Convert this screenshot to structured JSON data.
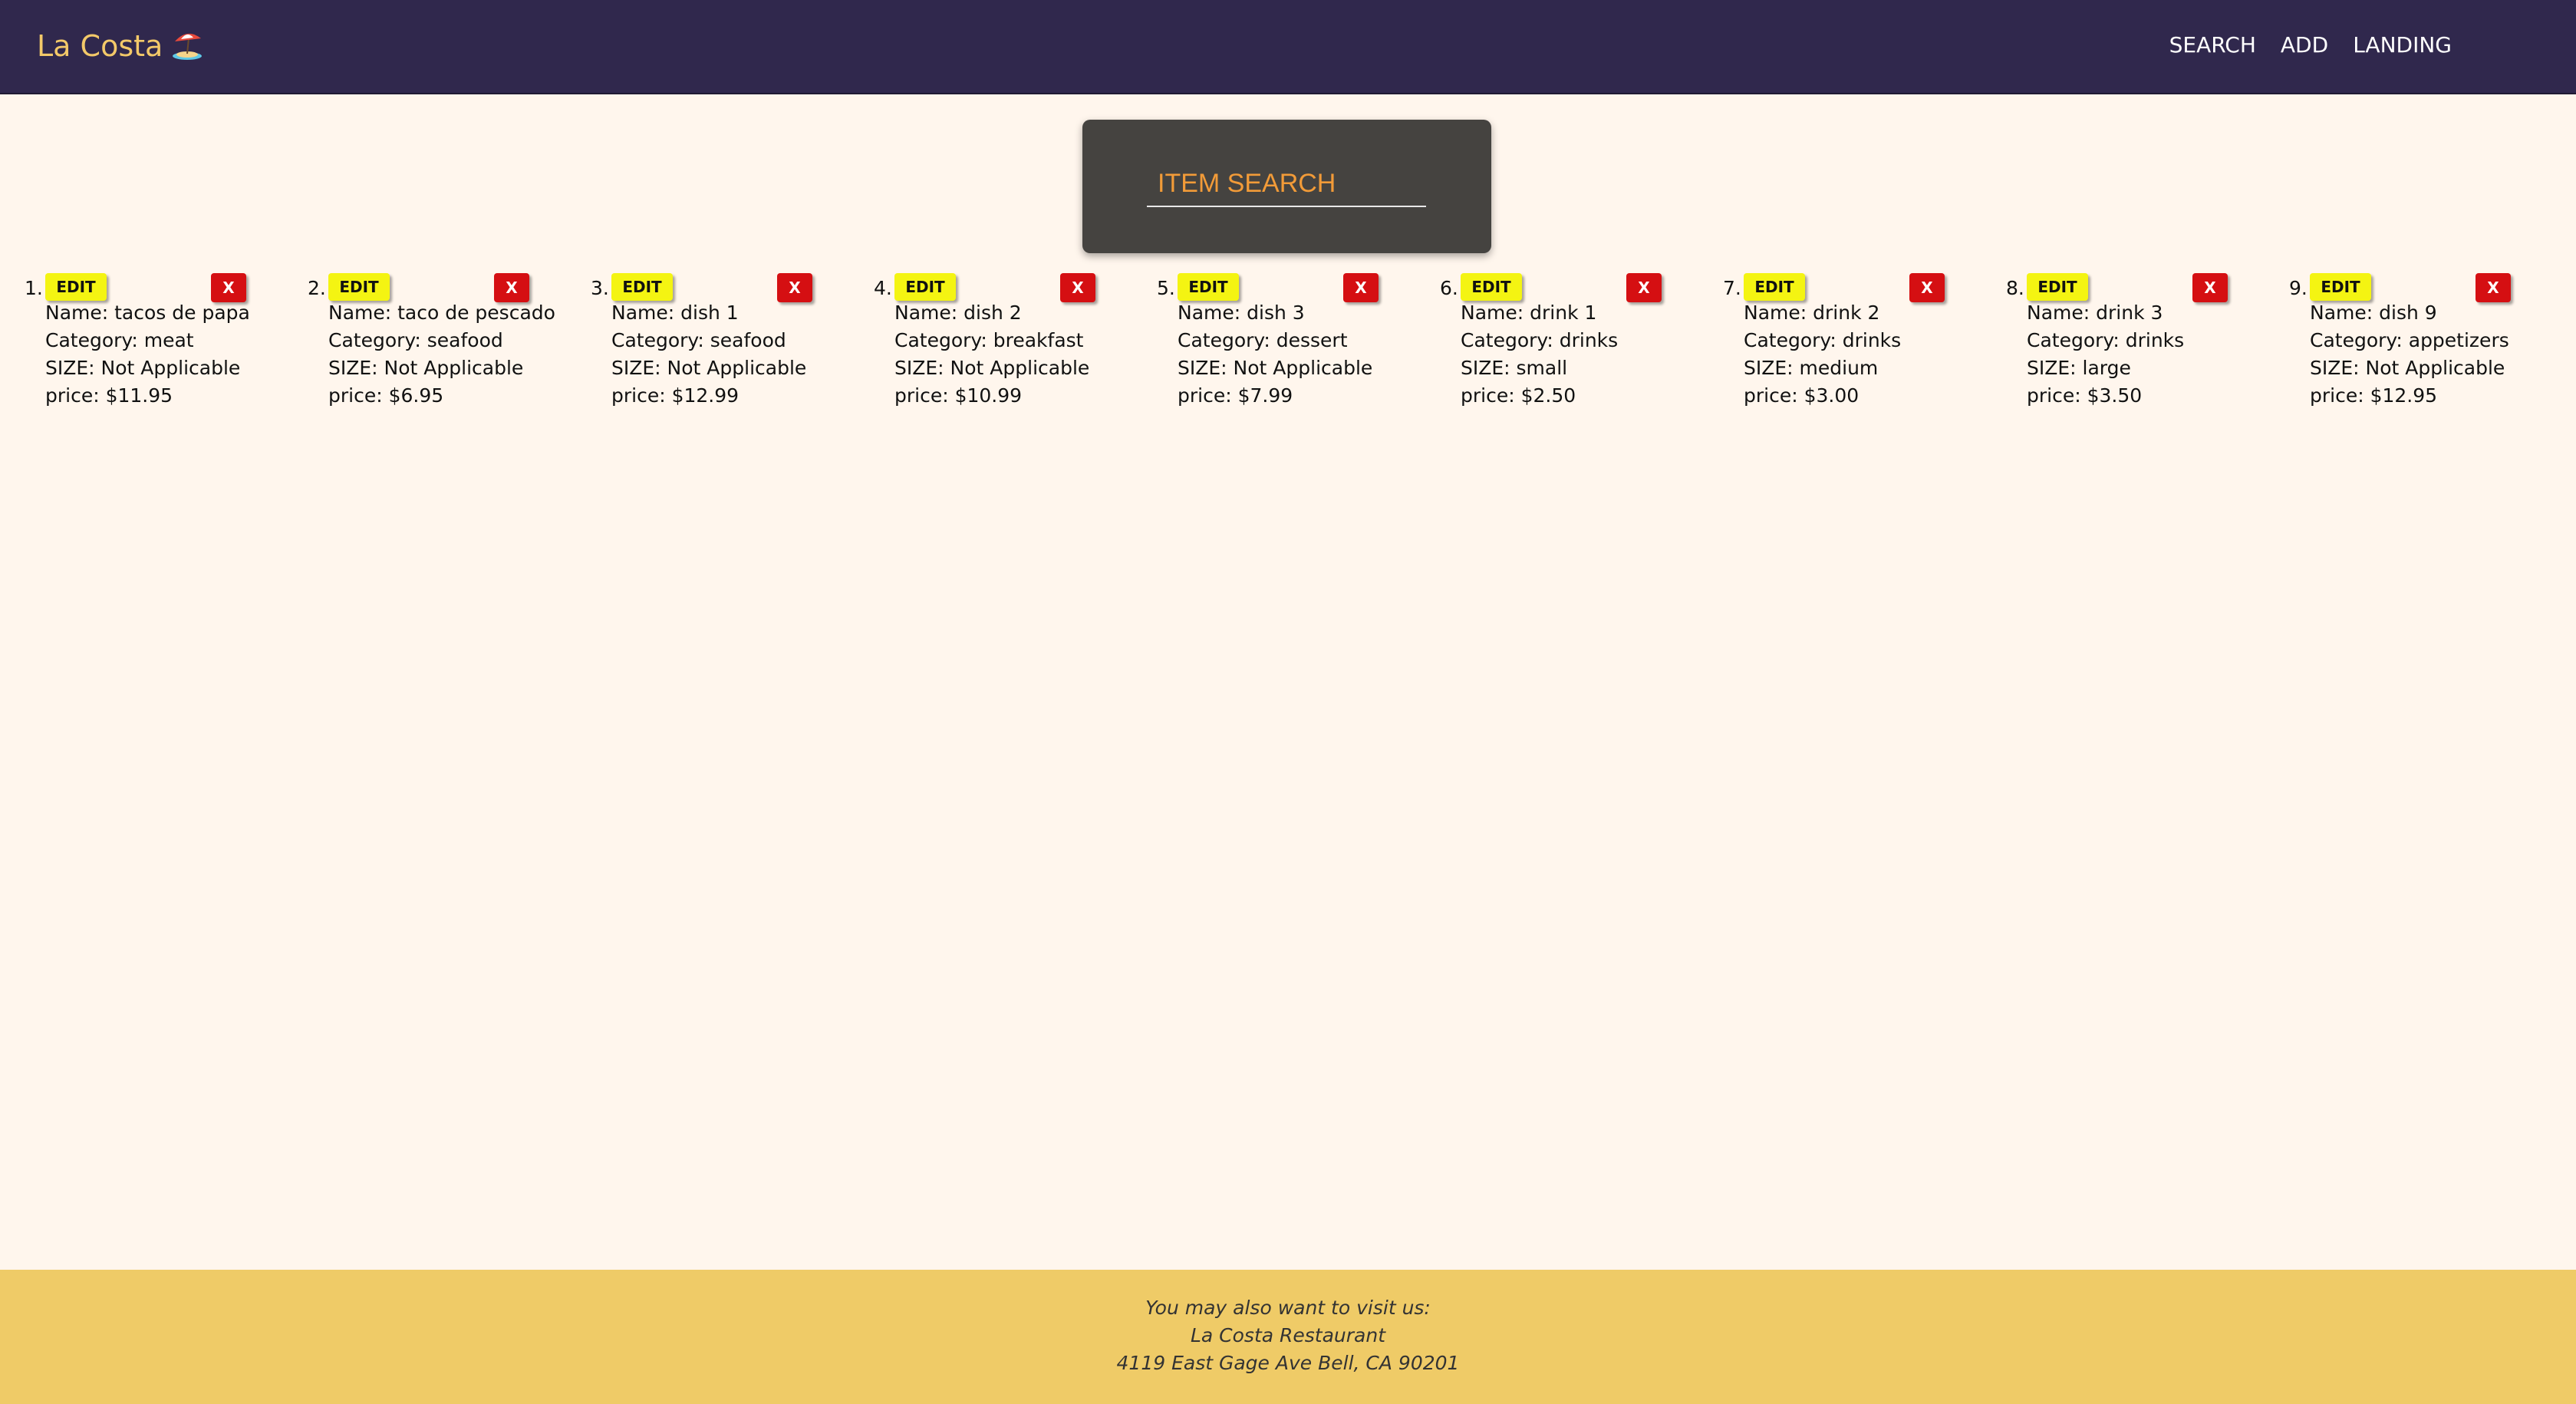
{
  "navbar": {
    "brand": "La Costa",
    "brand_icon": "beach-umbrella-icon",
    "links": [
      "SEARCH",
      "ADD",
      "LANDING"
    ]
  },
  "search": {
    "placeholder": "ITEM SEARCH"
  },
  "items": [
    {
      "number": "1.",
      "edit_label": "EDIT",
      "delete_label": "X",
      "name": "Name: tacos de papa",
      "category": "Category: meat",
      "size": "SIZE: Not Applicable",
      "price": "price: $11.95"
    },
    {
      "number": "2.",
      "edit_label": "EDIT",
      "delete_label": "X",
      "name": "Name: taco de pescado",
      "category": "Category: seafood",
      "size": "SIZE: Not Applicable",
      "price": "price: $6.95"
    },
    {
      "number": "3.",
      "edit_label": "EDIT",
      "delete_label": "X",
      "name": "Name: dish 1",
      "category": "Category: seafood",
      "size": "SIZE: Not Applicable",
      "price": "price: $12.99"
    },
    {
      "number": "4.",
      "edit_label": "EDIT",
      "delete_label": "X",
      "name": "Name: dish 2",
      "category": "Category: breakfast",
      "size": "SIZE: Not Applicable",
      "price": "price: $10.99"
    },
    {
      "number": "5.",
      "edit_label": "EDIT",
      "delete_label": "X",
      "name": "Name: dish 3",
      "category": "Category: dessert",
      "size": "SIZE: Not Applicable",
      "price": "price: $7.99"
    },
    {
      "number": "6.",
      "edit_label": "EDIT",
      "delete_label": "X",
      "name": "Name: drink 1",
      "category": "Category: drinks",
      "size": "SIZE: small",
      "price": "price: $2.50"
    },
    {
      "number": "7.",
      "edit_label": "EDIT",
      "delete_label": "X",
      "name": "Name: drink 2",
      "category": "Category: drinks",
      "size": "SIZE: medium",
      "price": "price: $3.00"
    },
    {
      "number": "8.",
      "edit_label": "EDIT",
      "delete_label": "X",
      "name": "Name: drink 3",
      "category": "Category: drinks",
      "size": "SIZE: large",
      "price": "price: $3.50"
    },
    {
      "number": "9.",
      "edit_label": "EDIT",
      "delete_label": "X",
      "name": "Name: dish 9",
      "category": "Category: appetizers",
      "size": "SIZE: Not Applicable",
      "price": "price: $12.95"
    }
  ],
  "footer": {
    "lines": [
      "You may also want to visit us:",
      "La Costa Restaurant",
      "4119 East Gage Ave Bell, CA 90201"
    ]
  },
  "colors": {
    "navbar_bg": "#30284d",
    "brand": "#f3c969",
    "page_bg": "#fff6ed",
    "search_card_bg": "#454340",
    "search_text": "#f29b38",
    "edit_button": "#f4f412",
    "delete_button": "#d50f12",
    "footer_bg": "#efcb67"
  }
}
